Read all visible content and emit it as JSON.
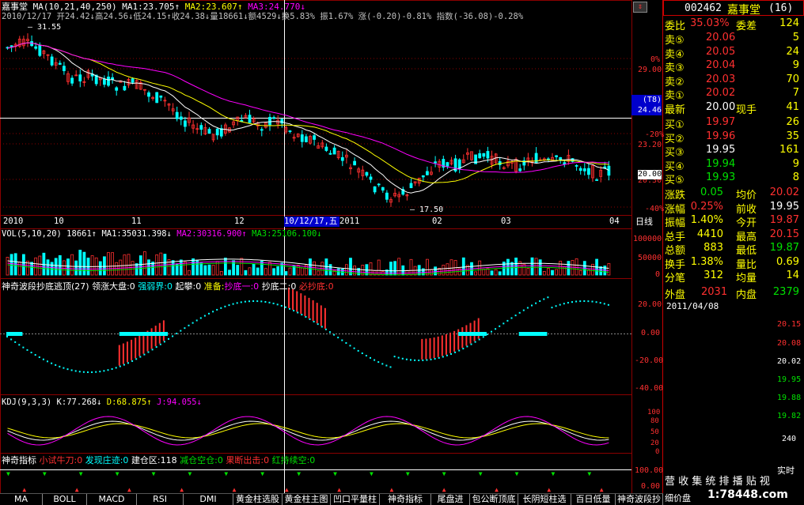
{
  "stock": {
    "code": "002462",
    "name": "嘉事堂",
    "num": "(16)"
  },
  "header": {
    "line1": "嘉事堂 MA(10,21,40,250)",
    "ma1": "MA1:23.705↑",
    "ma2": "MA2:23.607↑",
    "ma3": "MA3:24.770↓",
    "line2": "2010/12/17 开24.42↓高24.56↓低24.15↑收24.38↓量18661↓额4529↓换5.83% 振1.67% 涨(-0.20)-0.81% 指数(-36.08)-0.28%"
  },
  "price_axis": {
    "labels": [
      "0%",
      "29.00",
      "-20%",
      "23.20",
      "20.30",
      "-40%"
    ],
    "cursor_pct": "(T8)",
    "cursor_price": "24.46",
    "tag": "20.00",
    "label_high": "31.55",
    "label_low": "17.50"
  },
  "date_axis": {
    "labels": [
      "2010",
      "10",
      "11",
      "12",
      "2011",
      "02",
      "03",
      "04"
    ],
    "cursor": "10/12/17,五",
    "period": "日线"
  },
  "vol": {
    "title": "VOL(5,10,20) 18661↑",
    "ma1": "MA1:35031.398↓",
    "ma2": "MA2:30316.900↑",
    "ma3": "MA3:25106.100↓",
    "axis": [
      "100000",
      "50000",
      "0"
    ]
  },
  "sq": {
    "title": "神奇波段抄底逃顶(27)",
    "i1": "领涨大盘:0",
    "i2": "强弱界:0",
    "i3": "起攀:0",
    "i4": "准备:",
    "i5": "抄底一:0",
    "i6": "抄底二:0",
    "i7": "必抄底:0",
    "axis": [
      "20.00",
      "0.00",
      "-20.00",
      "-40.00"
    ]
  },
  "kdj": {
    "title": "KDJ(9,3,3)",
    "k": "K:77.268↓",
    "d": "D:68.875↑",
    "j": "J:94.055↓",
    "axis": [
      "100",
      "80",
      "50",
      "20",
      "0"
    ]
  },
  "shen": {
    "title": "神奇指标",
    "i1": "小试牛刀:0",
    "i2": "发现庄迹:0",
    "i3": "建仓区:118",
    "i4": "减仓空仓:0",
    "i5": "果断出击:0",
    "i6": "红持续空:0",
    "axis": [
      "100.00",
      "0.00"
    ]
  },
  "quote": {
    "weibi": "委比",
    "weibi_v": "35.03%",
    "weicha": "委差",
    "weicha_v": "124",
    "asks": [
      {
        "l": "卖⑤",
        "p": "20.06",
        "v": "5"
      },
      {
        "l": "卖④",
        "p": "20.05",
        "v": "24"
      },
      {
        "l": "卖③",
        "p": "20.04",
        "v": "9"
      },
      {
        "l": "卖②",
        "p": "20.03",
        "v": "70"
      },
      {
        "l": "卖①",
        "p": "20.02",
        "v": "7"
      }
    ],
    "last": "最新",
    "last_v": "20.00",
    "xs": "现手",
    "xs_v": "41",
    "bids": [
      {
        "l": "买①",
        "p": "19.97",
        "v": "26"
      },
      {
        "l": "买②",
        "p": "19.96",
        "v": "35"
      },
      {
        "l": "买③",
        "p": "19.95",
        "v": "161"
      },
      {
        "l": "买④",
        "p": "19.94",
        "v": "9"
      },
      {
        "l": "买⑤",
        "p": "19.93",
        "v": "8"
      }
    ],
    "stats": [
      {
        "a": "涨跌",
        "av": "0.05",
        "b": "均价",
        "bv": "20.02"
      },
      {
        "a": "涨幅",
        "av": "0.25%",
        "b": "前收",
        "bv": "19.95"
      },
      {
        "a": "振幅",
        "av": "1.40%",
        "b": "今开",
        "bv": "19.87"
      },
      {
        "a": "总手",
        "av": "4410",
        "b": "最高",
        "bv": "20.15"
      },
      {
        "a": "总额",
        "av": "883",
        "b": "最低",
        "bv": "19.87"
      },
      {
        "a": "换手",
        "av": "1.38%",
        "b": "量比",
        "bv": "0.69"
      },
      {
        "a": "分笔",
        "av": "312",
        "b": "均量",
        "bv": "14"
      }
    ],
    "waipan": "外盘",
    "waipan_v": "2031",
    "neipan": "内盘",
    "neipan_v": "2379"
  },
  "minute": {
    "date": "2011/04/08",
    "axis": [
      "20.15",
      "20.08",
      "20.02",
      "19.95",
      "19.88",
      "19.82",
      "240"
    ],
    "realtime": "实时"
  },
  "bottom_tabs": [
    "MA",
    "BOLL",
    "MACD",
    "RSI",
    "DMI",
    "黄金柱选股",
    "黄金柱主图",
    "凹口平量柱",
    "神奇指标",
    "尾盘进",
    "包公断顶底",
    "长阴短柱选",
    "百日低量",
    "神奇波段抄"
  ],
  "bottom_right": {
    "line1": "营 收 集 统 排 播 贴 视",
    "line2": "细价盘"
  },
  "watermark": "1:78448.com",
  "colors": {
    "up": "#ff3030",
    "down": "#00ffff",
    "ma1": "#ffffff",
    "ma2": "#ffff00",
    "ma3": "#ff00ff",
    "grid": "#8b0000"
  }
}
